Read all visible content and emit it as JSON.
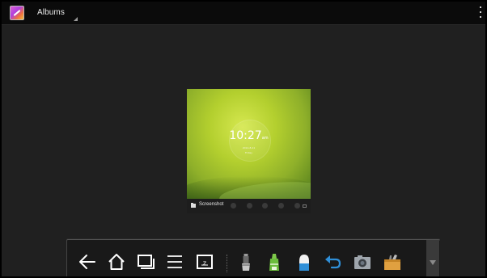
{
  "action_bar": {
    "title": "Albums",
    "app_icon": "gallery-app-icon",
    "overflow_icon": "overflow-menu-icon"
  },
  "album": {
    "name": "Screenshot",
    "thumbnail": {
      "time": "10:27",
      "ampm": "am",
      "date": "2014-8-11",
      "day": "Friday"
    }
  },
  "toolbar": {
    "buttons": [
      {
        "name": "back-icon"
      },
      {
        "name": "home-icon"
      },
      {
        "name": "recent-apps-icon"
      },
      {
        "name": "menu-icon"
      },
      {
        "name": "screenshot-icon"
      },
      {
        "name": "pen-icon"
      },
      {
        "name": "highlighter-icon"
      },
      {
        "name": "eraser-icon"
      },
      {
        "name": "undo-icon"
      },
      {
        "name": "camera-icon"
      },
      {
        "name": "toolbox-icon"
      }
    ],
    "collapse_icon": "collapse-arrow-icon"
  },
  "colors": {
    "background": "#202020",
    "action_bar": "#0b0b0b",
    "toolbar": "#191919",
    "accent_green": "#7ec84a",
    "accent_blue": "#2f8fd8"
  }
}
